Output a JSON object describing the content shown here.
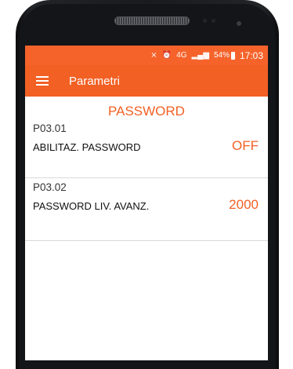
{
  "status_bar": {
    "icons": [
      "signal-mute-icon",
      "alarm-icon",
      "4g-icon",
      "cell-signal-icon"
    ],
    "network": "4G",
    "battery": "54%",
    "time": "17:03"
  },
  "app_bar": {
    "title": "Parametri"
  },
  "section": {
    "title": "PASSWORD"
  },
  "params": [
    {
      "code": "P03.01",
      "name": "ABILITAZ. PASSWORD",
      "value": "OFF"
    },
    {
      "code": "P03.02",
      "name": "PASSWORD LIV. AVANZ.",
      "value": "2000"
    }
  ],
  "colors": {
    "accent": "#f26024",
    "status_bar": "#f5632b"
  }
}
